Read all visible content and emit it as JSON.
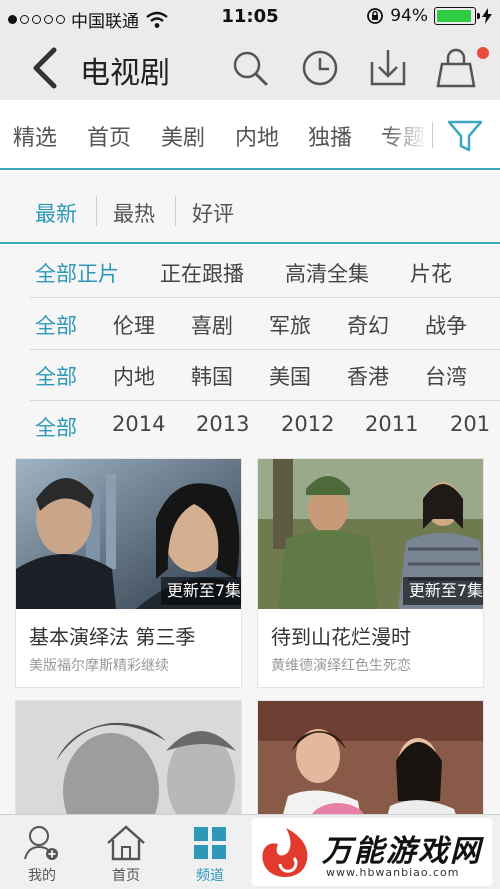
{
  "status_bar": {
    "carrier": "中国联通",
    "time": "11:05",
    "battery": "94%",
    "battery_level": 0.94
  },
  "nav": {
    "title": "电视剧"
  },
  "category_tabs": [
    "精选",
    "首页",
    "美剧",
    "内地",
    "独播",
    "专题"
  ],
  "sort": {
    "options": [
      "最新",
      "最热",
      "好评"
    ],
    "active": "最新"
  },
  "filters": [
    {
      "options": [
        "全部正片",
        "正在跟播",
        "高清全集",
        "片花"
      ]
    },
    {
      "options": [
        "全部",
        "伦理",
        "喜剧",
        "军旅",
        "奇幻",
        "战争"
      ]
    },
    {
      "options": [
        "全部",
        "内地",
        "韩国",
        "美国",
        "香港",
        "台湾"
      ]
    },
    {
      "options": [
        "全部",
        "2014",
        "2013",
        "2012",
        "2011",
        "201"
      ]
    }
  ],
  "shows": [
    {
      "title": "基本演绎法 第三季",
      "subtitle": "美版福尔摩斯精彩继续",
      "badge": "更新至7集"
    },
    {
      "title": "待到山花烂漫时",
      "subtitle": "黄维德演绎红色生死恋",
      "badge": "更新至7集"
    },
    {
      "title": "",
      "subtitle": "",
      "badge": ""
    },
    {
      "title": "",
      "subtitle": "",
      "badge": ""
    }
  ],
  "bottom_tabs": [
    {
      "label": "我的",
      "icon": "user-add-icon"
    },
    {
      "label": "首页",
      "icon": "home-icon"
    },
    {
      "label": "频道",
      "icon": "grid-icon",
      "active": true
    }
  ],
  "watermark": {
    "title": "万能游戏网",
    "url": "www.hbwanbiao.com"
  },
  "colors": {
    "accent": "#2d98b8",
    "bar_bg": "#ebebeb",
    "badge_red": "#e74c3c"
  }
}
